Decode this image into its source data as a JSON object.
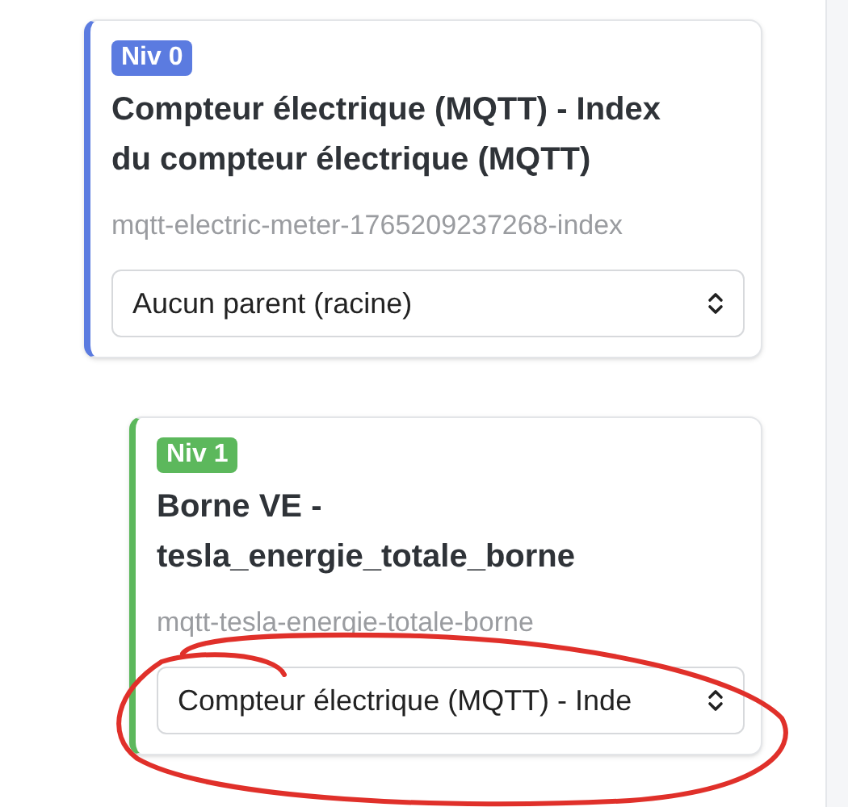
{
  "cards": [
    {
      "badge": "Niv 0",
      "color": "#5b7be0",
      "title": "Compteur électrique (MQTT) - Index du compteur électrique (MQTT)",
      "id": "mqtt-electric-meter-1765209237268-index",
      "parent_select": {
        "value": "Aucun parent (racine)"
      }
    },
    {
      "badge": "Niv 1",
      "color": "#5cb85c",
      "title": "Borne VE - tesla_energie_totale_borne",
      "id": "mqtt-tesla-energie-totale-borne",
      "parent_select": {
        "value": "Compteur électrique (MQTT) - Inde"
      }
    }
  ]
}
